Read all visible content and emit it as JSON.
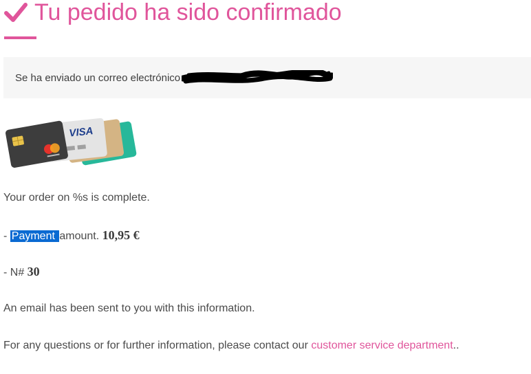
{
  "header": {
    "title": "Tu pedido ha sido confirmado",
    "check_icon": "checkmark-icon",
    "accent_color": "#e0559b"
  },
  "notice": {
    "text": "Se ha enviado un correo electrónico",
    "redaction_icon": "redacted-email-scribble"
  },
  "cards_image": {
    "icon": "credit-cards-icon",
    "visa_label": "VISA"
  },
  "order": {
    "complete_text": "Your order on %s is complete.",
    "payment_prefix": "- ",
    "payment_highlight": "Payment ",
    "payment_rest": "amount. ",
    "payment_value": "10,95 €",
    "number_prefix": "- N# ",
    "number_value": "30",
    "email_text": "An email has been sent to you with this information.",
    "contact_text": "For any questions or for further information, please contact our ",
    "contact_link": "customer service department",
    "contact_suffix": ".."
  }
}
